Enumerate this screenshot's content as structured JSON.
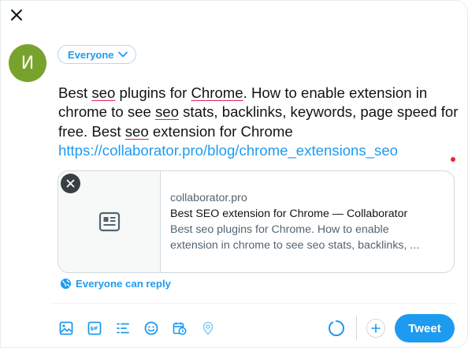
{
  "colors": {
    "accent": "#1d9bf0",
    "avatar_bg": "#77a32d",
    "spell_underline": "#e0245e",
    "text": "#0f1419",
    "muted": "#536471"
  },
  "user": {
    "avatar_letter": "И"
  },
  "audience": {
    "label": "Everyone",
    "icon": "chevron-down-icon"
  },
  "compose": {
    "segments": [
      {
        "text": "Best ",
        "style": "plain"
      },
      {
        "text": "seo",
        "style": "spell"
      },
      {
        "text": " plugins for ",
        "style": "plain"
      },
      {
        "text": "Chrome",
        "style": "spell"
      },
      {
        "text": ". How to enable extension in chrome to see ",
        "style": "plain"
      },
      {
        "text": "seo",
        "style": "spell"
      },
      {
        "text": " stats, backlinks, keywords, page speed for free. Best ",
        "style": "plain"
      },
      {
        "text": "seo",
        "style": "spell"
      },
      {
        "text": " extension for Chrome",
        "style": "plain"
      },
      {
        "text": "https://collaborator.pro/blog/chrome_extensions_seo",
        "style": "link"
      }
    ]
  },
  "link_card": {
    "domain": "collaborator.pro",
    "title": "Best SEO extension for Chrome — Collaborator",
    "description_line1": "Best seo plugins for Chrome. How to enable",
    "description_line2": "extension in chrome to see seo stats, backlinks, ...",
    "media_icon": "article-icon"
  },
  "reply_setting": {
    "label": "Everyone can reply",
    "icon": "globe-icon"
  },
  "toolbar": {
    "tools": [
      "image-icon",
      "gif-icon",
      "poll-icon",
      "emoji-icon",
      "schedule-icon",
      "location-icon"
    ]
  },
  "char_progress": 0.9,
  "tweet_button": {
    "label": "Tweet"
  }
}
